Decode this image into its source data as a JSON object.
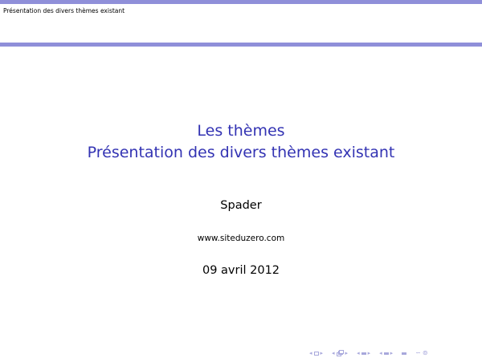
{
  "header": {
    "running_title": "Présentation des divers thèmes existant"
  },
  "titlepage": {
    "title": "Les thèmes",
    "subtitle": "Présentation des divers thèmes existant",
    "author": "Spader",
    "institute": "www.siteduzero.com",
    "date": "09 avril 2012"
  },
  "nav": {
    "left_arrow": "◂",
    "right_arrow": "▸",
    "back_forward_glyph": "∽",
    "search_glyph": "⊚"
  },
  "colors": {
    "accent": "#3333b3",
    "rule": "#8f8fd9",
    "nav": "#a8a8dc"
  }
}
